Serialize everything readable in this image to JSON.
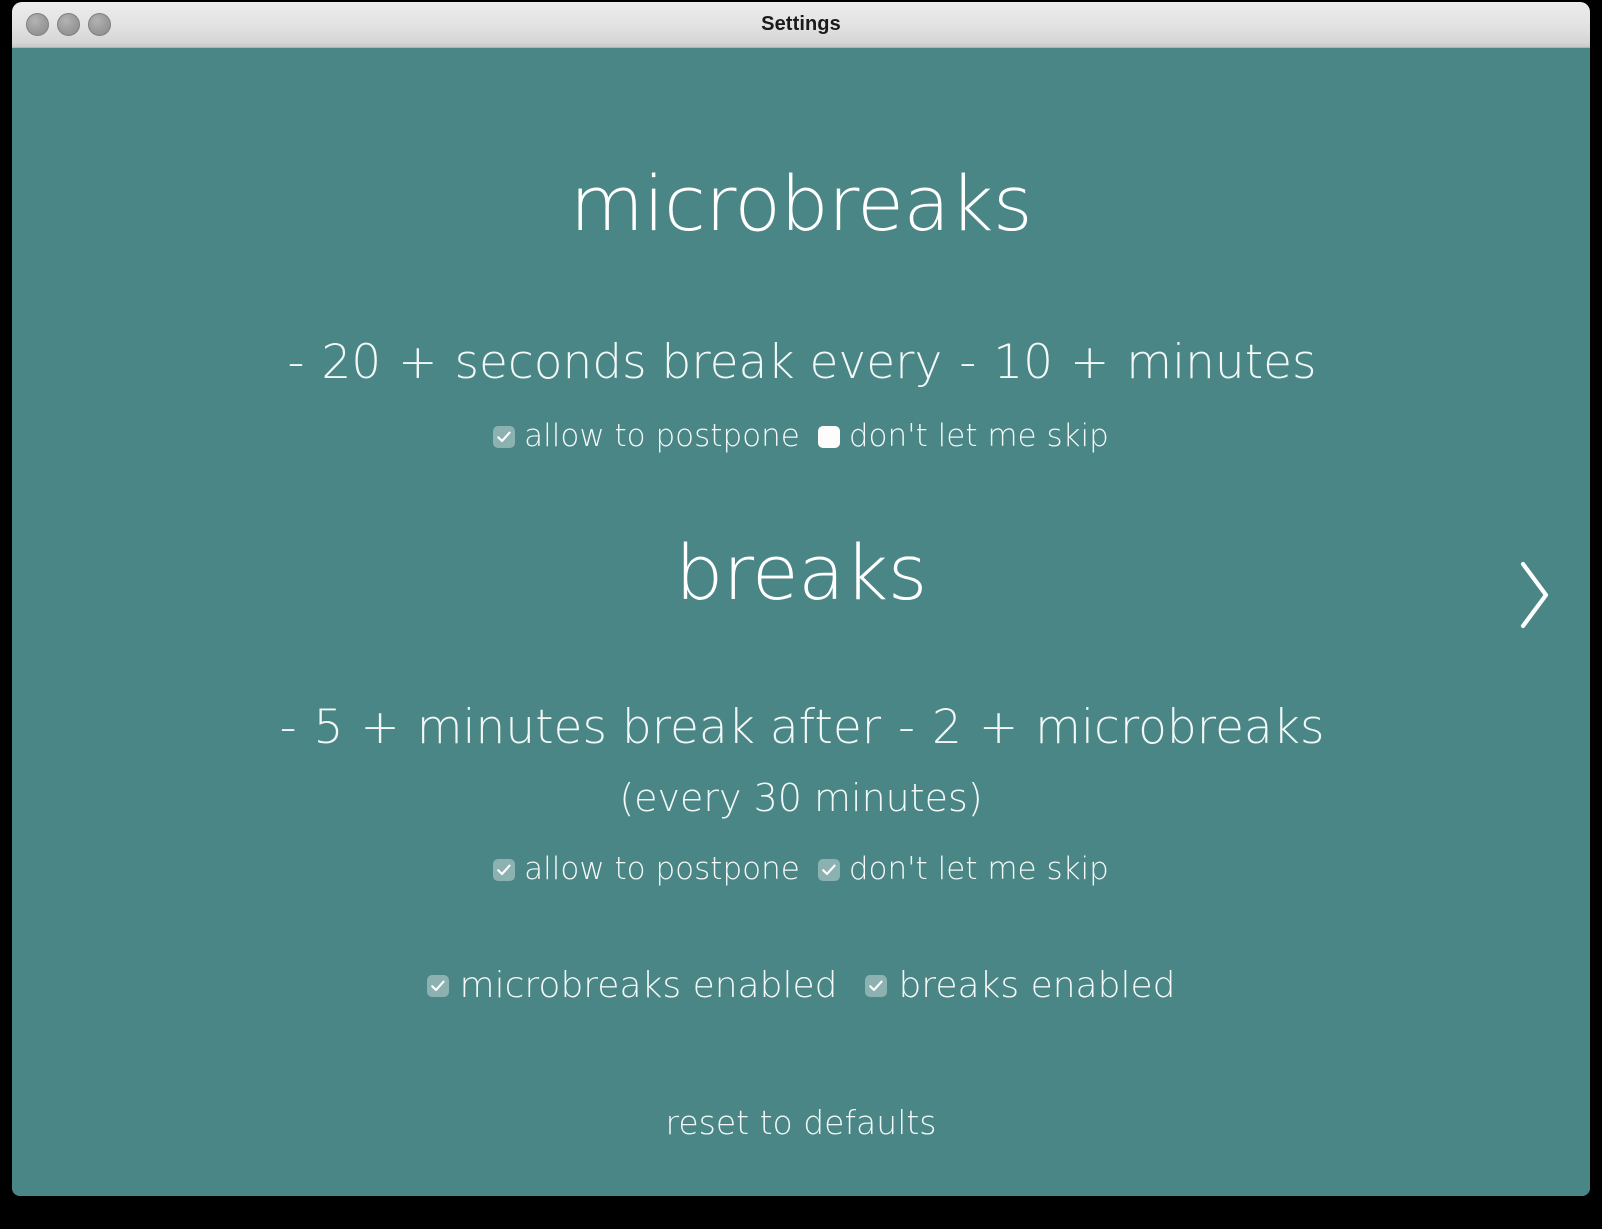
{
  "window": {
    "title": "Settings",
    "traffic_lights": [
      "close",
      "minimize",
      "zoom"
    ],
    "background_color": "#4a8685",
    "titlebar_color": "#e4e4e4",
    "text_color": "#ffffff"
  },
  "microbreaks": {
    "heading": "microbreaks",
    "duration": {
      "decrement": "-",
      "value": "20",
      "increment": "+",
      "unit": "seconds break every"
    },
    "interval": {
      "decrement": "-",
      "value": "10",
      "increment": "+",
      "unit": "minutes"
    },
    "checkboxes": [
      {
        "label": "allow to postpone",
        "checked": true
      },
      {
        "label": "don't let me skip",
        "checked": false
      }
    ]
  },
  "breaks": {
    "heading": "breaks",
    "duration": {
      "decrement": "-",
      "value": "5",
      "increment": "+",
      "unit": "minutes break after"
    },
    "count": {
      "decrement": "-",
      "value": "2",
      "increment": "+",
      "unit": "microbreaks"
    },
    "sub_note": "(every 30 minutes)",
    "checkboxes": [
      {
        "label": "allow to postpone",
        "checked": true
      },
      {
        "label": "don't let me skip",
        "checked": true
      }
    ]
  },
  "enabled_row": [
    {
      "label": "microbreaks enabled",
      "checked": true
    },
    {
      "label": "breaks enabled",
      "checked": true
    }
  ],
  "footer": {
    "reset_label": "reset to defaults"
  },
  "navigation": {
    "next_icon": "chevron-right-icon"
  }
}
